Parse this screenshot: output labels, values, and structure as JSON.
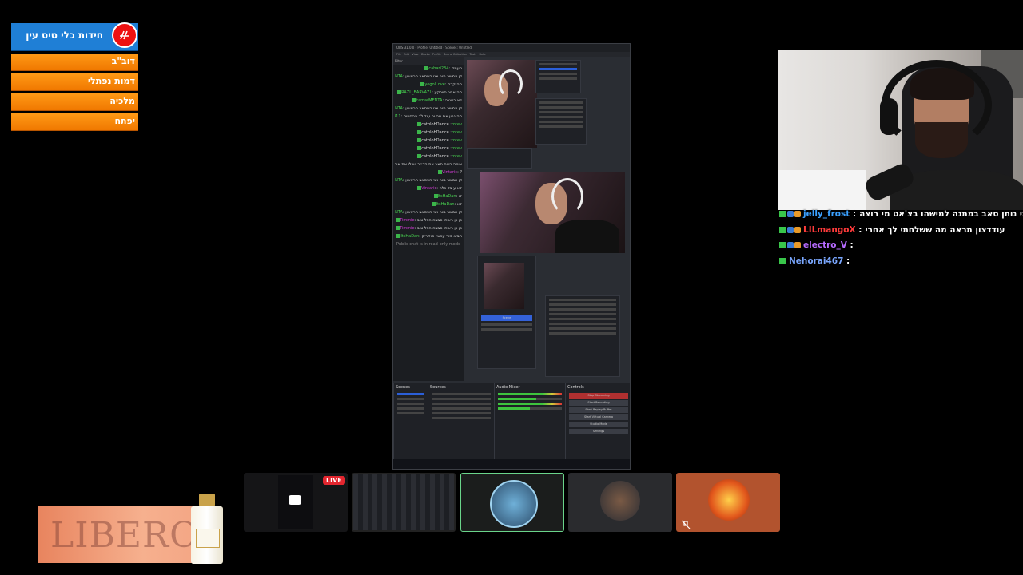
{
  "menu": {
    "title": "חידות כלי טיס עין",
    "items": [
      "דוב\"ב",
      "דמות נפתלי",
      "מלכיה",
      "יפתח"
    ]
  },
  "shared_screen": {
    "window_title": "OBS 31.0.0 - Profile: Untitled - Scenes: Untitled",
    "chat_header": "Filter",
    "chat_lines": [
      {
        "user": "cabari234",
        "text": "סעמק"
      },
      {
        "user": "ItamarMENTA",
        "text": "דן אמשר מור אני הפסאב הראשון"
      },
      {
        "user": "yegolLove",
        "text": "מה קרה"
      },
      {
        "user": "RAZL_BARVAZL",
        "text": "מה אמר סייבקע"
      },
      {
        "user": "ItamarMENTA",
        "text": "לא בסגנה"
      },
      {
        "user": "ItamarMENTA",
        "text": "דן אמשר מור אני הפסאב הראשון"
      },
      {
        "user": "yoavvv311",
        "text": "מה נבון את מה יה עוד לך ההספים"
      },
      {
        "user": "rotev",
        "text": "catblobDance"
      },
      {
        "user": "rotev",
        "text": "catblobDance"
      },
      {
        "user": "rotev",
        "text": "catblobDance"
      },
      {
        "user": "rotev",
        "text": "catblobDance"
      },
      {
        "user": "rotev",
        "text": "catblobDance"
      },
      {
        "user": "PodDass555",
        "text": "אימה האם סאב את הד״ב יש לי את אותו סט כמו ביוטיוב אף אחד לא יכל לעשות את האשו עוד כי אמשר דן"
      },
      {
        "user": "Vintaric",
        "text": "?"
      },
      {
        "user": "ItamarMENTA",
        "text": "דן אמשר מור אני הפסאב הראשון"
      },
      {
        "user": "Vintaric",
        "text": "לא ע בד כלה"
      },
      {
        "user": "ItsHaDan",
        "text": "לו"
      },
      {
        "user": "ItsHaDan",
        "text": "לא"
      },
      {
        "user": "ItamarMENTA",
        "text": "דן אמשר מור אני הפסאב הראשון"
      },
      {
        "user": "Timmie",
        "text": "כן כן ראיתי סבבה הכל טוב"
      },
      {
        "user": "Timmie",
        "text": "כן כן ראיתי סבבה הכל טוב"
      },
      {
        "user": "ItsHaDan",
        "text": "תביא מור עכשיו סוקריק"
      }
    ],
    "chat_footer": "Public chat is in read-only mode",
    "scenes_label": "Scenes",
    "sources_label": "Sources",
    "audio_label": "Audio Mixer",
    "controls_label": "Controls",
    "controls": [
      "Stop Streaming",
      "Start Recording",
      "Start Replay Buffer",
      "Start Virtual Camera",
      "Studio Mode",
      "Settings"
    ]
  },
  "webcam_chat": [
    {
      "name": "jelly_frost",
      "name_color": "#3aa0ff",
      "text": "אני נותן סאב במתנה למישהו בצ'אט מי רוצה"
    },
    {
      "name": "LILmangoX",
      "name_color": "#ff3b3b",
      "text": "עודדצון תראה מה ששלחתי לך אחרי"
    },
    {
      "name": "electro_V",
      "name_color": "#b66bff",
      "text": ""
    },
    {
      "name": "Nehorai467",
      "name_color": "#7aa7ff",
      "text": ""
    }
  ],
  "tiles": {
    "live_label": "LIVE"
  },
  "ad": {
    "brand": "LIBERO"
  }
}
